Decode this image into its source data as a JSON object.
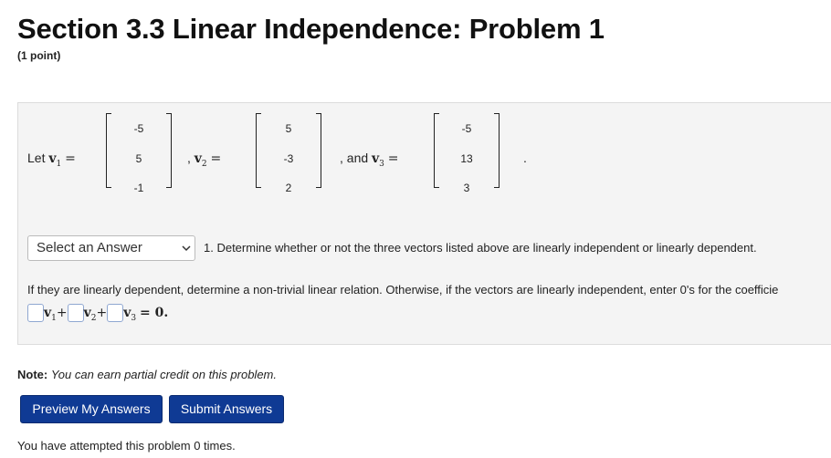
{
  "header": {
    "title": "Section 3.3 Linear Independence: Problem 1",
    "points": "(1 point)"
  },
  "problem": {
    "let_text": "Let",
    "v1_label": "v",
    "v1_sub": "1",
    "eq": "=",
    "comma1": ",",
    "v2_label": "v",
    "v2_sub": "2",
    "and_text": ", and",
    "v3_label": "v",
    "v3_sub": "3",
    "period": ".",
    "v1": [
      "-5",
      "5",
      "-1"
    ],
    "v2": [
      "5",
      "-3",
      "2"
    ],
    "v3": [
      "-5",
      "13",
      "3"
    ],
    "select_value": "Select an Answer",
    "question1": "1. Determine whether or not the three vectors listed above are linearly independent or linearly dependent.",
    "question2": "If they are linearly dependent, determine a non-trivial linear relation. Otherwise, if the vectors are linearly independent, enter 0's for the coefficie",
    "relation": {
      "v": "v",
      "sub1": "1",
      "sub2": "2",
      "sub3": "3",
      "plus": "+",
      "equals": "= 0."
    }
  },
  "note": {
    "label": "Note:",
    "text": "You can earn partial credit on this problem."
  },
  "buttons": {
    "preview": "Preview My Answers",
    "submit": "Submit Answers"
  },
  "footer": {
    "attempts": "You have attempted this problem 0 times."
  },
  "colors": {
    "button_bg": "#0f3a94",
    "box_bg": "#f4f4f4",
    "input_border": "#8fa7d1"
  },
  "icons": {
    "select_arrow": "chevron-down-icon"
  }
}
